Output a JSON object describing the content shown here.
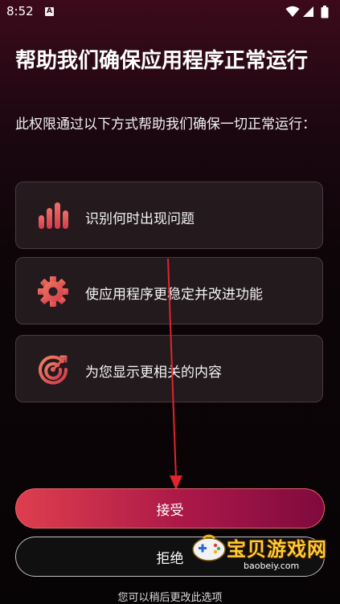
{
  "status_bar": {
    "time": "8:52",
    "notification_icon": "A"
  },
  "title": "帮助我们确保应用程序正常运行",
  "subtitle": "此权限通过以下方式帮助我们确保一切正常运行：",
  "cards": [
    {
      "icon": "bar-chart-icon",
      "label": "识别何时出现问题"
    },
    {
      "icon": "gear-icon",
      "label": "使应用程序更稳定并改进功能"
    },
    {
      "icon": "target-icon",
      "label": "为您显示更相关的内容"
    }
  ],
  "buttons": {
    "accept": "接受",
    "reject": "拒绝"
  },
  "footer_note": "您可以稍后更改此选项",
  "watermark": {
    "text": "宝贝游戏网",
    "domain": "baobeiy.com"
  },
  "colors": {
    "accent": "#e14a54",
    "accent_dark": "#7f0a3e",
    "arrow": "#e0242e"
  }
}
